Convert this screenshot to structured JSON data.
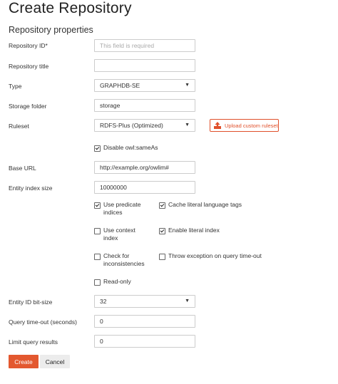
{
  "page": {
    "title": "Create Repository",
    "section": "Repository properties"
  },
  "fields": {
    "repo_id": {
      "label": "Repository ID*",
      "placeholder": "This field is required",
      "value": ""
    },
    "repo_title": {
      "label": "Repository title",
      "value": ""
    },
    "type": {
      "label": "Type",
      "value": "GRAPHDB-SE"
    },
    "storage": {
      "label": "Storage folder",
      "value": "storage"
    },
    "ruleset": {
      "label": "Ruleset",
      "value": "RDFS-Plus (Optimized)",
      "upload_label": "Upload custom ruleset"
    },
    "disable_sameas": {
      "label": "Disable owl:sameAs",
      "checked": true
    },
    "base_url": {
      "label": "Base URL",
      "value": "http://example.org/owlim#"
    },
    "entity_index": {
      "label": "Entity index size",
      "value": "10000000"
    },
    "entity_bits": {
      "label": "Entity ID bit-size",
      "value": "32"
    },
    "timeout": {
      "label": "Query time-out (seconds)",
      "value": "0"
    },
    "limit": {
      "label": "Limit query results",
      "value": "0"
    }
  },
  "options": {
    "predicate_indices": {
      "line1": "Use predicate",
      "line2": "indices",
      "checked": true
    },
    "cache_lang": {
      "line1": "Cache literal language tags",
      "checked": true
    },
    "context_index": {
      "line1": "Use context",
      "line2": "index",
      "checked": false
    },
    "literal_index": {
      "line1": "Enable literal index",
      "checked": true
    },
    "check_incons": {
      "line1": "Check for",
      "line2": "inconsistencies",
      "checked": false
    },
    "throw_timeout": {
      "line1": "Throw exception on query time-out",
      "checked": false
    },
    "read_only": {
      "line1": "Read-only",
      "checked": false
    }
  },
  "actions": {
    "create": "Create",
    "cancel": "Cancel"
  },
  "colors": {
    "accent": "#e3582f"
  }
}
